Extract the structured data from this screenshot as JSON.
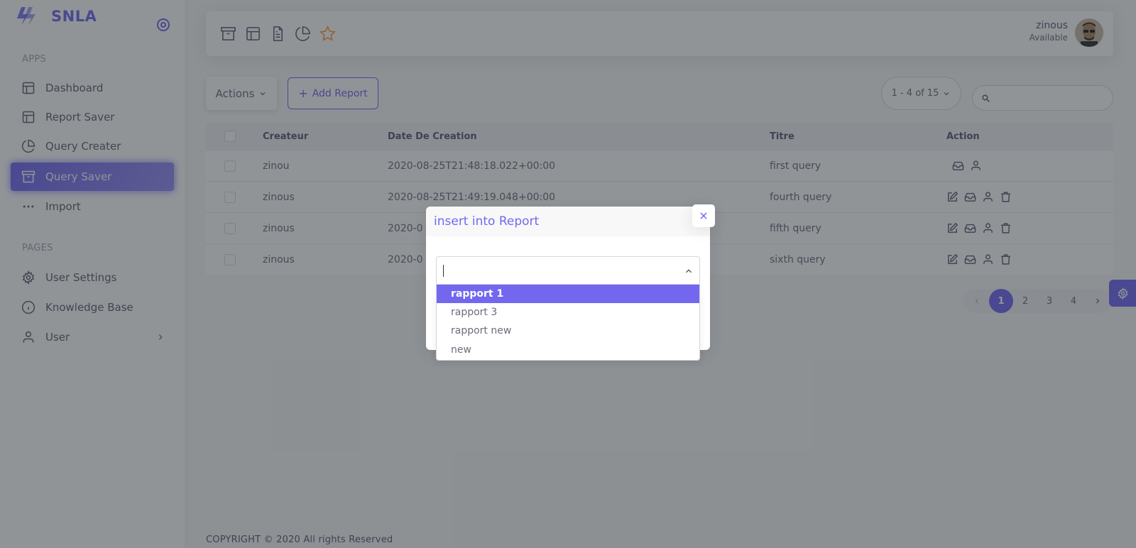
{
  "brand": {
    "name": "SNLA"
  },
  "sidebar": {
    "apps_label": "APPS",
    "pages_label": "PAGES",
    "apps": [
      {
        "label": "Dashboard",
        "icon": "layout-icon"
      },
      {
        "label": "Report Saver",
        "icon": "layout-icon"
      },
      {
        "label": "Query Creater",
        "icon": "pie-chart-icon"
      },
      {
        "label": "Query Saver",
        "icon": "archive-icon",
        "active": true
      },
      {
        "label": "Import",
        "icon": "more-horizontal-icon"
      }
    ],
    "pages": [
      {
        "label": "User Settings",
        "icon": "settings-icon"
      },
      {
        "label": "Knowledge Base",
        "icon": "info-icon"
      },
      {
        "label": "User",
        "icon": "user-icon"
      }
    ]
  },
  "navbar": {
    "icons": [
      "archive-icon",
      "layout-icon",
      "file-text-icon",
      "pie-chart-icon",
      "star-icon"
    ],
    "user_name": "zinous",
    "user_status": "Available"
  },
  "toolbar": {
    "actions_label": "Actions",
    "add_report_label": "Add Report",
    "page_range": "1 - 4 of 15",
    "search_value": ""
  },
  "table": {
    "columns": [
      "Createur",
      "Date De Creation",
      "Titre",
      "Action"
    ],
    "rows": [
      {
        "createur": "zinou",
        "date": "2020-08-25T21:48:18.022+00:00",
        "titre": "first query",
        "actions": [
          "inbox",
          "user"
        ]
      },
      {
        "createur": "zinous",
        "date": "2020-08-25T21:49:19.048+00:00",
        "titre": "fourth query",
        "actions": [
          "edit",
          "inbox",
          "user",
          "trash"
        ]
      },
      {
        "createur": "zinous",
        "date": "2020-0",
        "titre": "fifth query",
        "actions": [
          "edit",
          "inbox",
          "user",
          "trash"
        ]
      },
      {
        "createur": "zinous",
        "date": "2020-0",
        "titre": "sixth query",
        "actions": [
          "edit",
          "inbox",
          "user",
          "trash"
        ]
      }
    ]
  },
  "pagination": {
    "pages": [
      "1",
      "2",
      "3",
      "4"
    ],
    "current": "1"
  },
  "footer": {
    "text": "COPYRIGHT © 2020 All rights Reserved"
  },
  "modal": {
    "title": "insert into Report",
    "select_value": "",
    "options": [
      "rapport 1",
      "rapport 3",
      "rapport new",
      "new"
    ],
    "highlighted": "rapport 1"
  },
  "colors": {
    "primary": "#7367f0",
    "star": "#ff9f43",
    "overlay": "rgba(34,41,47,0.5)"
  }
}
